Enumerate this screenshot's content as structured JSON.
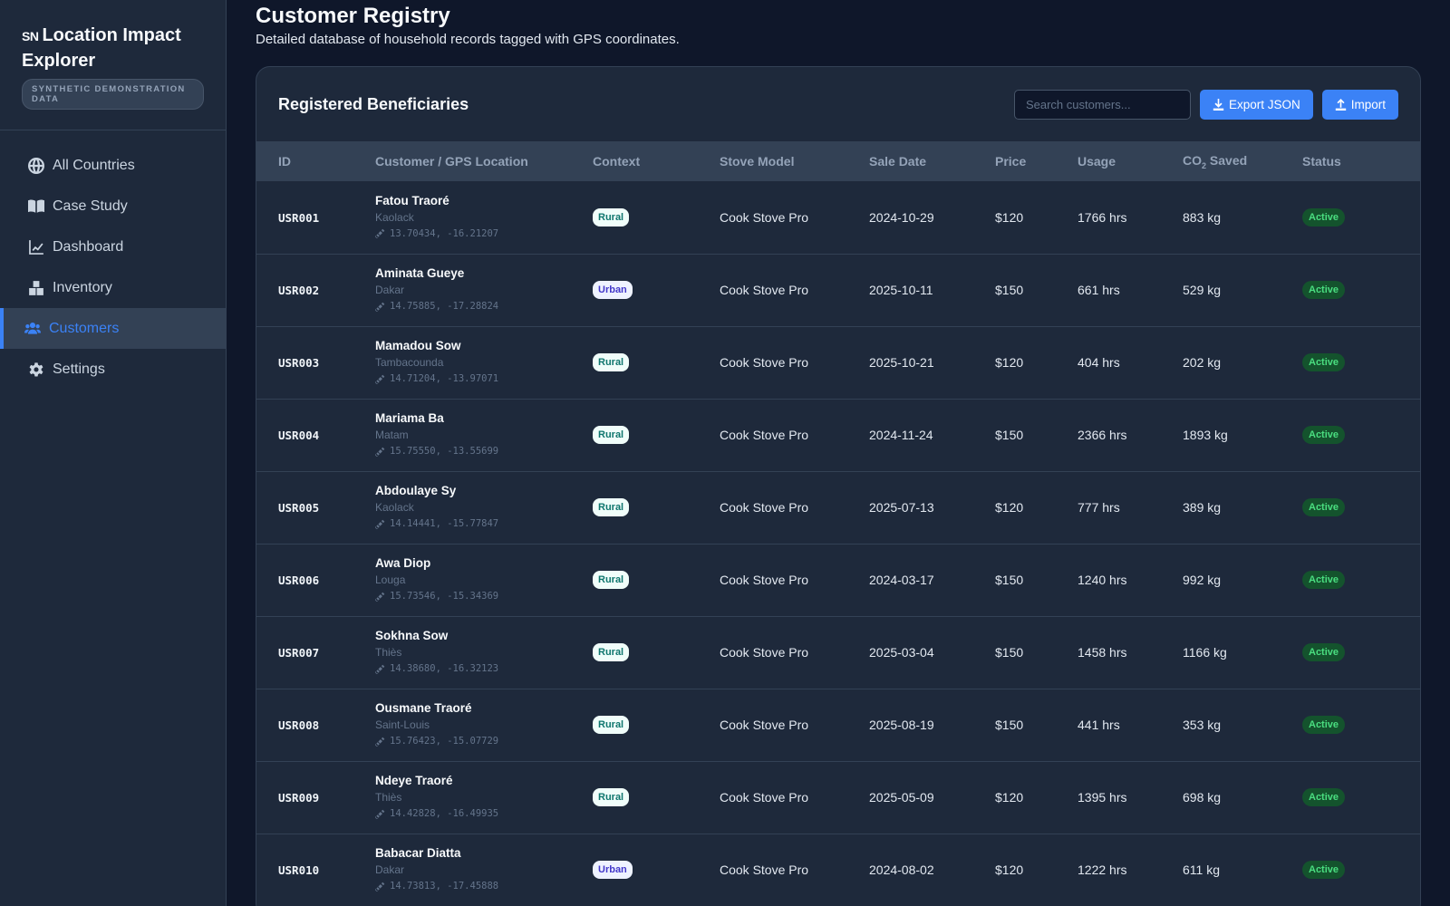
{
  "app": {
    "code": "SN",
    "title": "Location Impact Explorer",
    "badge": "SYNTHETIC DEMONSTRATION DATA"
  },
  "nav": [
    {
      "label": "All Countries",
      "icon": "globe-icon"
    },
    {
      "label": "Case Study",
      "icon": "book-icon"
    },
    {
      "label": "Dashboard",
      "icon": "chart-line-icon"
    },
    {
      "label": "Inventory",
      "icon": "boxes-icon"
    },
    {
      "label": "Customers",
      "icon": "users-icon",
      "active": true
    },
    {
      "label": "Settings",
      "icon": "gear-icon"
    }
  ],
  "page": {
    "title": "Customer Registry",
    "subtitle": "Detailed database of household records tagged with GPS coordinates."
  },
  "card": {
    "title": "Registered Beneficiaries",
    "search_placeholder": "Search customers...",
    "export_label": "Export JSON",
    "import_label": "Import"
  },
  "table": {
    "columns": {
      "id": "ID",
      "customer": "Customer / GPS Location",
      "context": "Context",
      "stove": "Stove Model",
      "date": "Sale Date",
      "price": "Price",
      "usage": "Usage",
      "co2_prefix": "CO",
      "co2_sub": "2",
      "co2_suffix": " Saved",
      "status": "Status"
    },
    "rows": [
      {
        "id": "USR001",
        "name": "Fatou Traoré",
        "city": "Kaolack",
        "gps": "13.70434, -16.21207",
        "context": "Rural",
        "stove": "Cook Stove Pro",
        "date": "2024-10-29",
        "price": "$120",
        "usage": "1766 hrs",
        "co2": "883 kg",
        "status": "Active"
      },
      {
        "id": "USR002",
        "name": "Aminata Gueye",
        "city": "Dakar",
        "gps": "14.75885, -17.28824",
        "context": "Urban",
        "stove": "Cook Stove Pro",
        "date": "2025-10-11",
        "price": "$150",
        "usage": "661 hrs",
        "co2": "529 kg",
        "status": "Active"
      },
      {
        "id": "USR003",
        "name": "Mamadou Sow",
        "city": "Tambacounda",
        "gps": "14.71204, -13.97071",
        "context": "Rural",
        "stove": "Cook Stove Pro",
        "date": "2025-10-21",
        "price": "$120",
        "usage": "404 hrs",
        "co2": "202 kg",
        "status": "Active"
      },
      {
        "id": "USR004",
        "name": "Mariama Ba",
        "city": "Matam",
        "gps": "15.75550, -13.55699",
        "context": "Rural",
        "stove": "Cook Stove Pro",
        "date": "2024-11-24",
        "price": "$150",
        "usage": "2366 hrs",
        "co2": "1893 kg",
        "status": "Active"
      },
      {
        "id": "USR005",
        "name": "Abdoulaye Sy",
        "city": "Kaolack",
        "gps": "14.14441, -15.77847",
        "context": "Rural",
        "stove": "Cook Stove Pro",
        "date": "2025-07-13",
        "price": "$120",
        "usage": "777 hrs",
        "co2": "389 kg",
        "status": "Active"
      },
      {
        "id": "USR006",
        "name": "Awa Diop",
        "city": "Louga",
        "gps": "15.73546, -15.34369",
        "context": "Rural",
        "stove": "Cook Stove Pro",
        "date": "2024-03-17",
        "price": "$150",
        "usage": "1240 hrs",
        "co2": "992 kg",
        "status": "Active"
      },
      {
        "id": "USR007",
        "name": "Sokhna Sow",
        "city": "Thiès",
        "gps": "14.38680, -16.32123",
        "context": "Rural",
        "stove": "Cook Stove Pro",
        "date": "2025-03-04",
        "price": "$150",
        "usage": "1458 hrs",
        "co2": "1166 kg",
        "status": "Active"
      },
      {
        "id": "USR008",
        "name": "Ousmane Traoré",
        "city": "Saint-Louis",
        "gps": "15.76423, -15.07729",
        "context": "Rural",
        "stove": "Cook Stove Pro",
        "date": "2025-08-19",
        "price": "$150",
        "usage": "441 hrs",
        "co2": "353 kg",
        "status": "Active"
      },
      {
        "id": "USR009",
        "name": "Ndeye Traoré",
        "city": "Thiès",
        "gps": "14.42828, -16.49935",
        "context": "Rural",
        "stove": "Cook Stove Pro",
        "date": "2025-05-09",
        "price": "$120",
        "usage": "1395 hrs",
        "co2": "698 kg",
        "status": "Active"
      },
      {
        "id": "USR010",
        "name": "Babacar Diatta",
        "city": "Dakar",
        "gps": "14.73813, -17.45888",
        "context": "Urban",
        "stove": "Cook Stove Pro",
        "date": "2024-08-02",
        "price": "$120",
        "usage": "1222 hrs",
        "co2": "611 kg",
        "status": "Active"
      }
    ]
  },
  "colors": {
    "accent": "#3b82f6",
    "background": "#0f172a",
    "panel": "#1e293b",
    "status_active": "#4ade80"
  }
}
